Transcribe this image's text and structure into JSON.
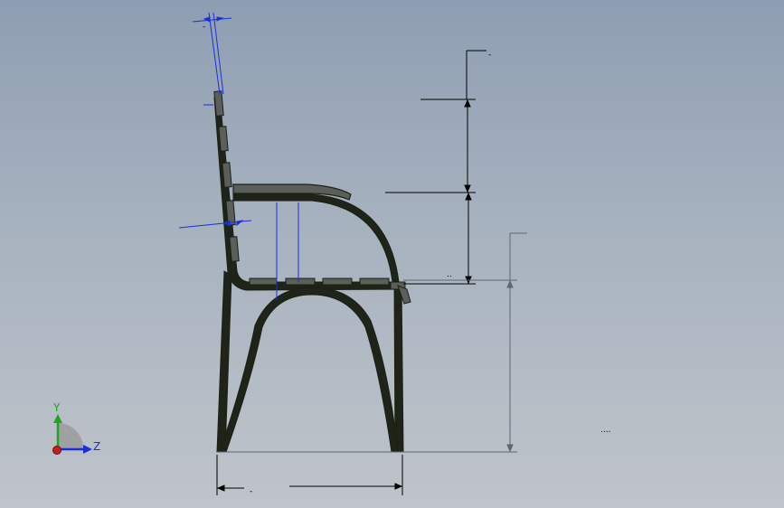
{
  "triad": {
    "y_label": "Y",
    "z_label": "Z",
    "y_color": "#1fa51f",
    "z_color": "#1a2fd8",
    "origin_color": "#c81e1e"
  },
  "colors": {
    "frame_fill": "#1e2418",
    "frame_inner": "#66716a",
    "slat_fill": "#5a5f5a",
    "slat_edge": "#1c2014",
    "dimension_line": "#000000",
    "dimension_line_grey": "#5f6670",
    "annotation_blue": "#1a2fd8"
  },
  "dimension_labels": {
    "small_text_a": "-",
    "small_text_b": "-",
    "small_text_c": "-",
    "small_text_d": "..",
    "small_text_e": "...."
  }
}
